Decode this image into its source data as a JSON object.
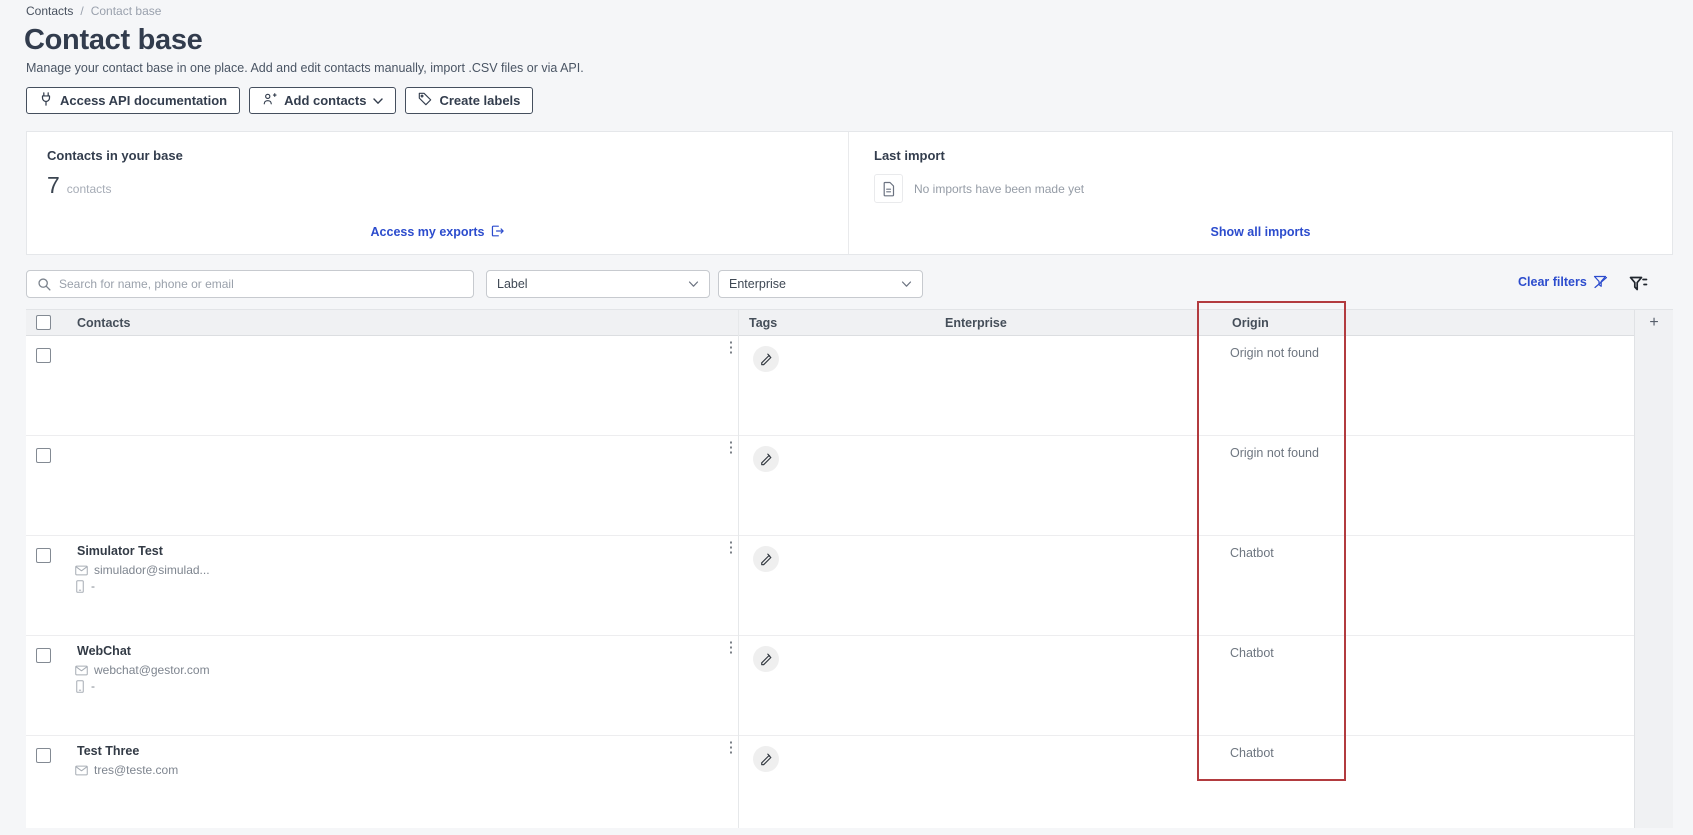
{
  "breadcrumb": {
    "home": "Contacts",
    "separator": "/",
    "current": "Contact base"
  },
  "header": {
    "title": "Contact base",
    "subtitle": "Manage your contact base in one place. Add and edit contacts manually, import .CSV files or via API.",
    "actions": {
      "api_docs": "Access API documentation",
      "add_contacts": "Add contacts",
      "create_labels": "Create labels"
    }
  },
  "summary_cards": {
    "contacts_card": {
      "title": "Contacts in your base",
      "count": "7",
      "count_unit": "contacts",
      "link": "Access my exports"
    },
    "import_card": {
      "title": "Last import",
      "empty_message": "No imports have been made yet",
      "link": "Show all imports"
    }
  },
  "filter_bar": {
    "search_placeholder": "Search for name, phone or email",
    "label_filter_value": "Label",
    "enterprise_filter_value": "Enterprise",
    "clear_filters": "Clear filters"
  },
  "table": {
    "columns": {
      "contacts": "Contacts",
      "tags": "Tags",
      "enterprise": "Enterprise",
      "origin": "Origin"
    },
    "add_column_label": "+",
    "rows": [
      {
        "origin": "Origin not found"
      },
      {
        "origin": "Origin not found"
      },
      {
        "name": "Simulator Test",
        "email": "simulador@simulad...",
        "phone": "-",
        "origin": "Chatbot"
      },
      {
        "name": "WebChat",
        "email": "webchat@gestor.com",
        "phone": "-",
        "origin": "Chatbot"
      },
      {
        "name": "Test Three",
        "email": "tres@teste.com",
        "origin": "Chatbot"
      }
    ]
  },
  "annotation": {
    "highlighted_column": "Origin",
    "color": "#b23b3f"
  },
  "icons": {
    "kebab": "⋮"
  },
  "colors": {
    "accent_blue": "#2c4ccd",
    "annotation_red": "#b23b3f",
    "page_background": "#f5f6f8"
  }
}
